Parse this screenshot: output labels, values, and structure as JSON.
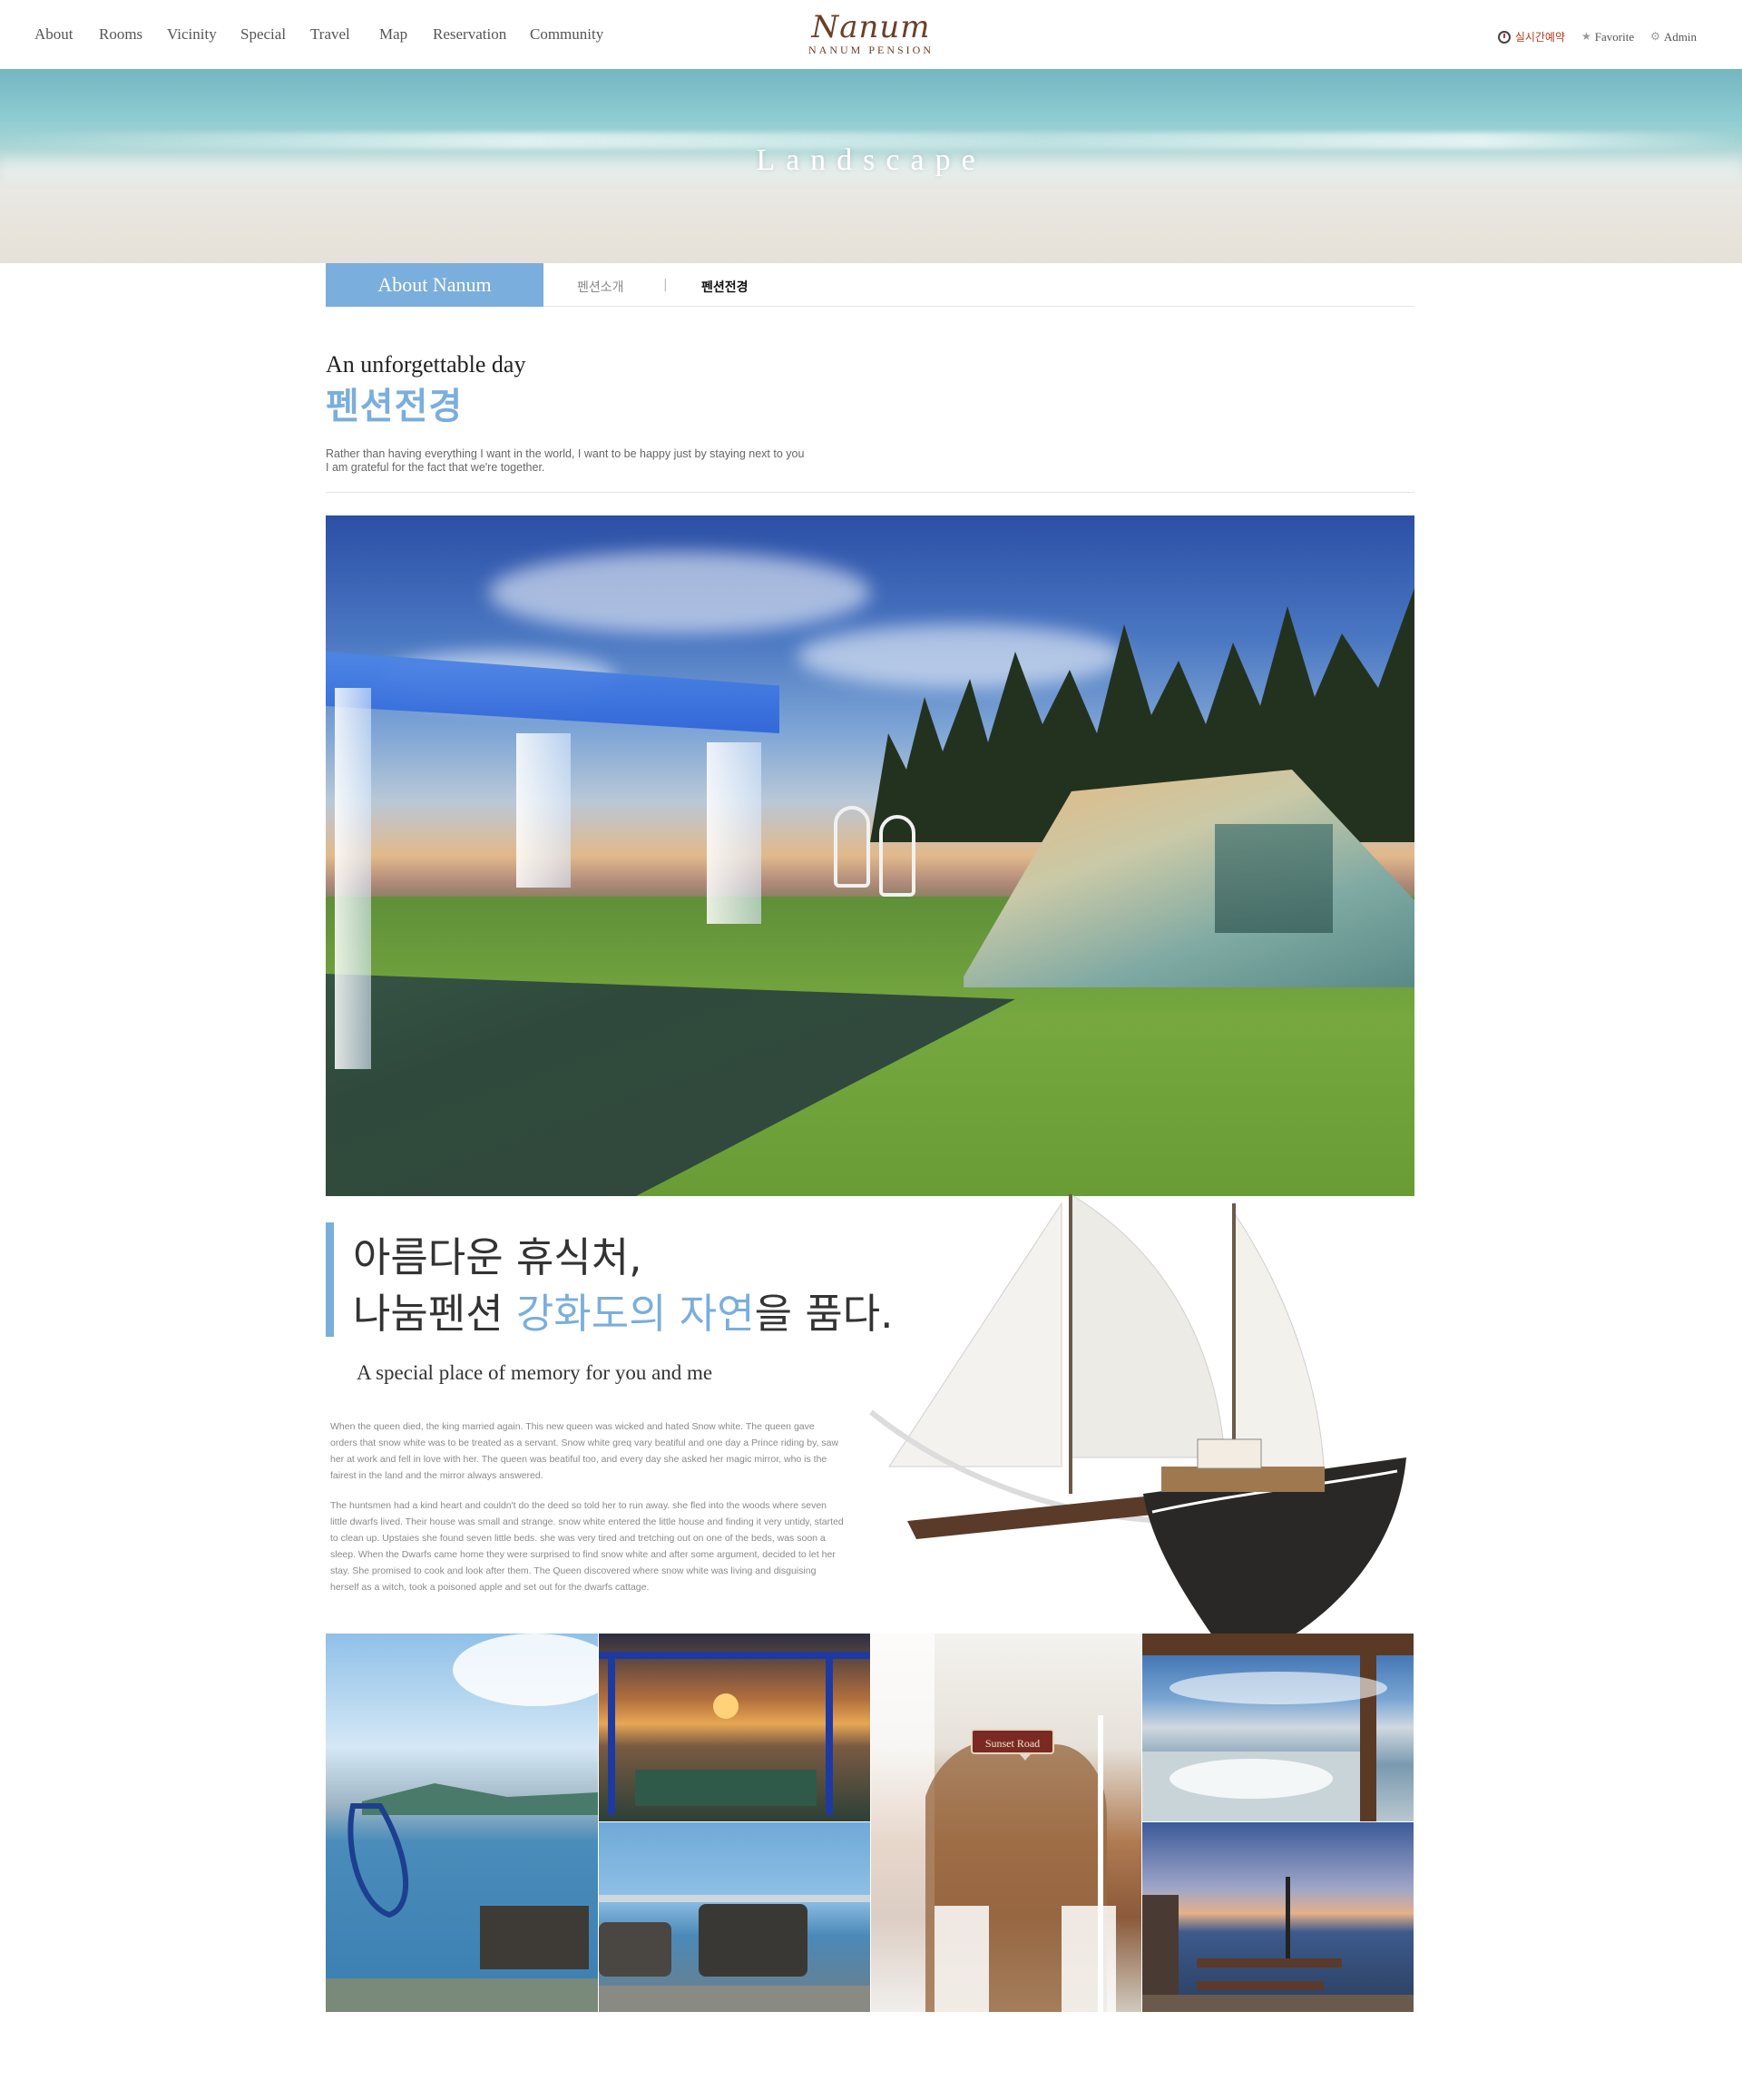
{
  "nav": {
    "items": [
      {
        "label": "About"
      },
      {
        "label": "Rooms"
      },
      {
        "label": "Vicinity"
      },
      {
        "label": "Special"
      },
      {
        "label": "Travel"
      },
      {
        "label": "Map"
      },
      {
        "label": "Reservation"
      },
      {
        "label": "Community"
      }
    ]
  },
  "logo": {
    "script": "Nanum",
    "sub": "NANUM PENSION"
  },
  "util": {
    "realtime": "실시간예약",
    "favorite": "Favorite",
    "admin": "Admin"
  },
  "hero": {
    "title": "Landscape"
  },
  "subnav": {
    "section": "About Nanum",
    "tab1": "펜션소개",
    "sep": "|",
    "tab2": "펜션전경"
  },
  "intro": {
    "eyebrow": "An unforgettable day",
    "title": "펜션전경",
    "desc_line1": "Rather than having everything I want in the world, I want to be happy just by staying next to you",
    "desc_line2": "I am grateful for the fact that we're together."
  },
  "feature": {
    "title_line1": "아름다운 휴식처,",
    "title_line2_a": "나눔펜션 ",
    "title_line2_hl": "강화도의 자연",
    "title_line2_b": "을 품다.",
    "subtitle": "A special place of memory for you and me",
    "para1": "When the queen died, the king married again. This new queen was wicked and hated Snow white. The queen gave orders that snow white was to be treated as a servant. Snow white greq vary beatiful and one day a Prince riding by, saw her at work and fell in love with her. The queen was beatiful too, and every day she asked her magic mirror, who is the fairest in the land and the mirror always answered.",
    "para2": "The huntsmen had a kind heart and couldn't do the deed so told her to run away. she fled into the woods where seven little dwarfs lived. Their house was small and strange. snow white entered the little house and finding it very untidy, started to clean up. Upstaies she found seven little beds. she was very tired and tretching out on one of the beds, was soon a sleep. When the Dwarfs came home they were surprised to find snow white and after some argument, decided to let her stay. She promised to cook and look after them. The Queen discovered where snow white was living and disguising herself as a witch, took a poisoned apple and set out for the dwarfs cattage."
  },
  "gallery": {
    "sign": "Sunset Road"
  },
  "colors": {
    "accent": "#7aaedc",
    "brand_brown": "#6a4028",
    "realtime_red": "#b33a1c"
  }
}
